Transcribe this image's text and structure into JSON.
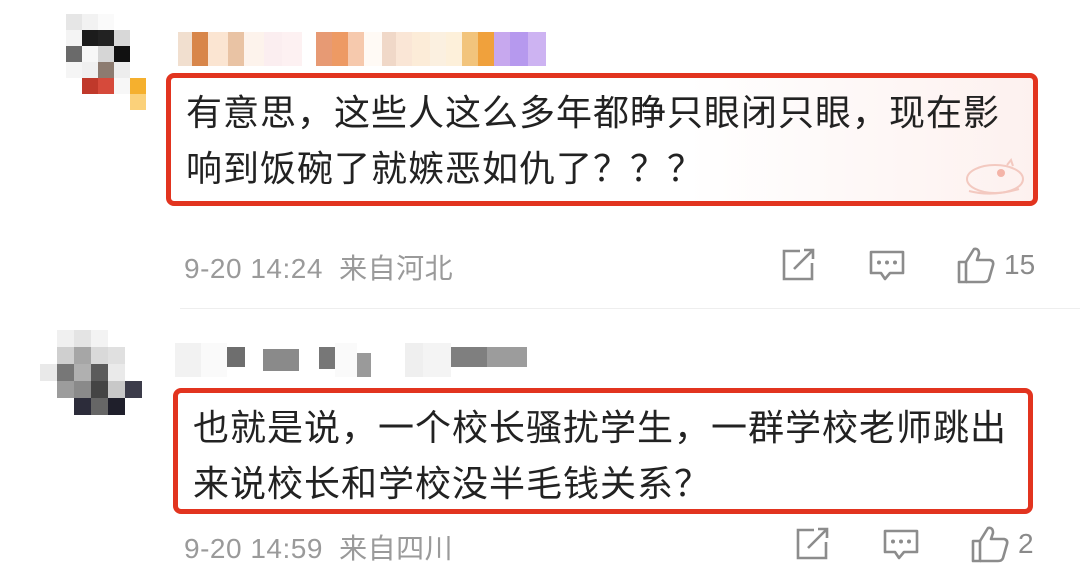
{
  "comments": [
    {
      "text": "有意思，这些人这么多年都睁只眼闭只眼，现在影响到饭碗了就嫉恶如仇了？？？",
      "time": "9-20 14:24",
      "location": "来自河北",
      "likes": "15"
    },
    {
      "text": "也就是说，一个校长骚扰学生，一群学校老师跳出来说校长和学校没半毛钱关系？",
      "time": "9-20 14:59",
      "location": "来自四川",
      "likes": "2"
    }
  ],
  "icons": {
    "forward": "share-icon",
    "reply": "comment-icon",
    "like": "thumbs-up-icon"
  },
  "colors": {
    "highlight_border": "#e2341f",
    "meta_text": "#9a9a9a"
  }
}
